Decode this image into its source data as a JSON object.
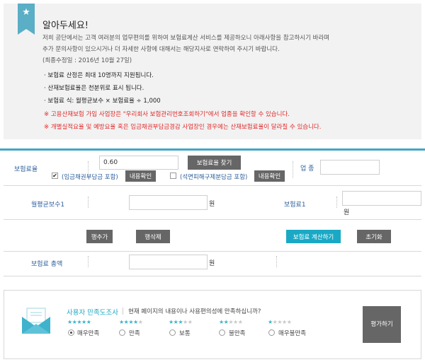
{
  "notice": {
    "title": "알아두세요!",
    "para1": "저희 공단에서는 고객 여러분의 업무편의를 위하여 보험료계산 서비스를 제공하오니 아래사항을 참고하시기 바라며",
    "para2": "추가 문의사항이 있으시거나 더 자세한 사항에 대해서는 해당지사로 연락하여 주시기 바랍니다.",
    "updated": "(최종수정일 : 2016년 10월 27일)",
    "bullets": [
      "· 보험료 산정은 최대 10명까지 지원됩니다.",
      "· 산재보험료율은 천분위로 표시 됩니다.",
      "· 보험료 식: 월평균보수 × 보험료율 ÷ 1,000"
    ],
    "warnings": [
      "※ 고용산재보험 가입 사업장은 \"우리회사 보험관리번호조회하기\"에서 업종을 확인할 수 있습니다.",
      "※ 개별실적요율 및 예방요율 혹은 임금채권부담금경감 사업장인 경우에는 산재보험료율이 달라질 수 있습니다."
    ],
    "icon": "star-icon",
    "accent": "#5aaec5"
  },
  "form": {
    "rate_label": "보험료율",
    "rate_value": "0.60",
    "find_rate_button": "보험료율 찾기",
    "check1_label": "(임금채권부담금 포함)",
    "check1_checked": true,
    "check1_confirm": "내용확인",
    "check2_label": "(석면피해구제분담금 포함)",
    "check2_checked": false,
    "check2_confirm": "내용확인",
    "industry_label": "업 종",
    "industry_value": "",
    "monthly_label": "월평균보수1",
    "monthly_value": "",
    "monthly_unit": "원",
    "premium_label": "보험료1",
    "premium_value": "",
    "premium_unit": "원",
    "add_row_button": "행추가",
    "delete_row_button": "행삭제",
    "calc_button": "보험료 계산하기",
    "reset_button": "초기화",
    "total_label": "보험료 총액",
    "total_value": "",
    "total_unit": "원",
    "accent": "#1aa9c5"
  },
  "survey": {
    "title": "사용자 만족도조사",
    "question": "현재 페이지의 내용이나 사용편의성에 만족하십니까?",
    "options": [
      {
        "label": "매우만족",
        "stars": 5,
        "selected": true
      },
      {
        "label": "만족",
        "stars": 4,
        "selected": false
      },
      {
        "label": "보통",
        "stars": 3,
        "selected": false
      },
      {
        "label": "불만족",
        "stars": 2,
        "selected": false
      },
      {
        "label": "매우불만족",
        "stars": 1,
        "selected": false
      }
    ],
    "submit_button": "평가하기",
    "icon": "envelope-icon"
  }
}
